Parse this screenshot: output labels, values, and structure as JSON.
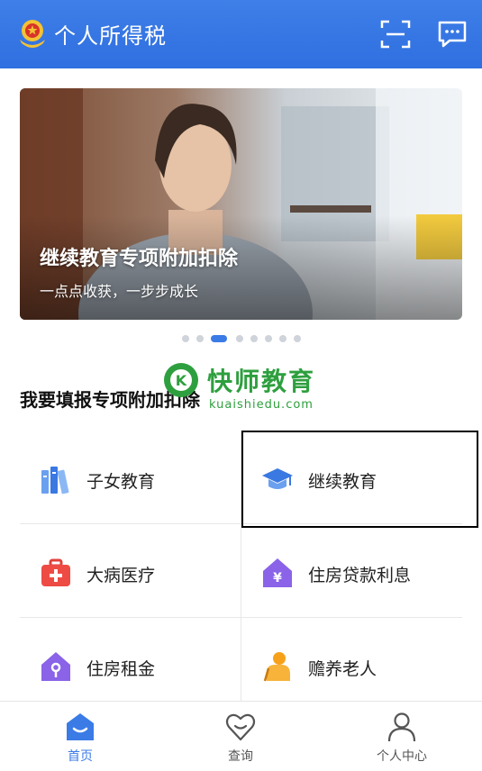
{
  "header": {
    "title": "个人所得税",
    "scan_icon": "scan-icon",
    "message_icon": "message-icon"
  },
  "banner": {
    "title": "继续教育专项附加扣除",
    "subtitle": "一点点收获，一步步成长",
    "dots_total": 8,
    "active_dot": 3
  },
  "watermark": {
    "name": "快师教育",
    "domain": "kuaishiedu.com"
  },
  "section": {
    "title": "我要填报专项附加扣除"
  },
  "items": [
    {
      "label": "子女教育",
      "icon": "books-icon"
    },
    {
      "label": "继续教育",
      "icon": "graduation-cap-icon"
    },
    {
      "label": "大病医疗",
      "icon": "medical-kit-icon"
    },
    {
      "label": "住房贷款利息",
      "icon": "house-loan-icon"
    },
    {
      "label": "住房租金",
      "icon": "house-rent-icon"
    },
    {
      "label": "赡养老人",
      "icon": "elderly-icon"
    }
  ],
  "tabs": [
    {
      "label": "首页",
      "icon": "home-icon",
      "active": true
    },
    {
      "label": "查询",
      "icon": "heart-query-icon",
      "active": false
    },
    {
      "label": "个人中心",
      "icon": "person-icon",
      "active": false
    }
  ],
  "colors": {
    "header": "#3476e3",
    "accent": "#3b7be6",
    "watermark": "#2e9f3e"
  }
}
